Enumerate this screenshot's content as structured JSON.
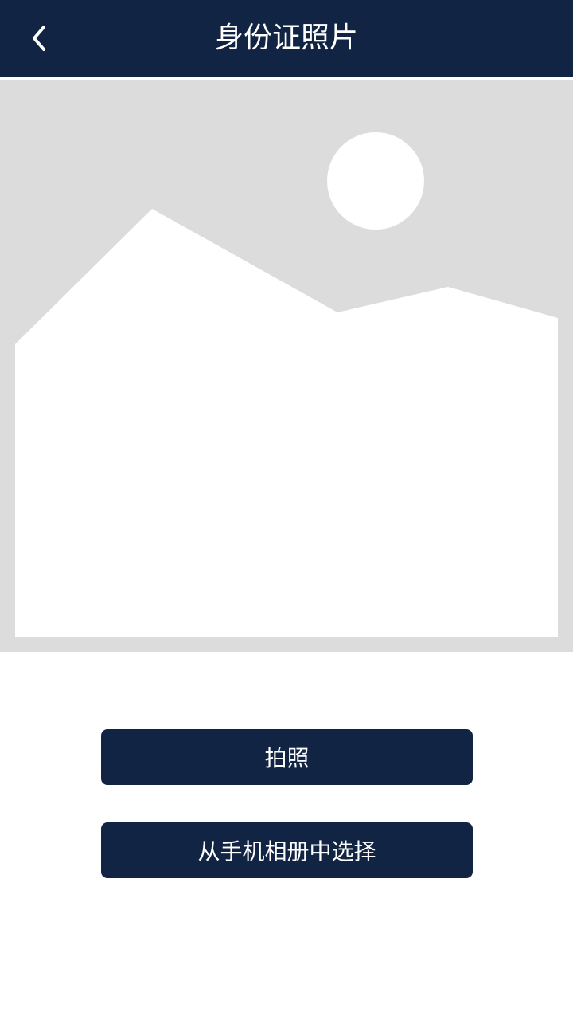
{
  "header": {
    "title": "身份证照片",
    "back_icon": "chevron-left-icon"
  },
  "photo": {
    "placeholder_icon": "image-placeholder-icon"
  },
  "actions": {
    "take_photo_label": "拍照",
    "choose_from_album_label": "从手机相册中选择"
  },
  "colors": {
    "primary": "#122443",
    "placeholder_bg": "#dcdcdc",
    "placeholder_fg": "#ffffff"
  }
}
